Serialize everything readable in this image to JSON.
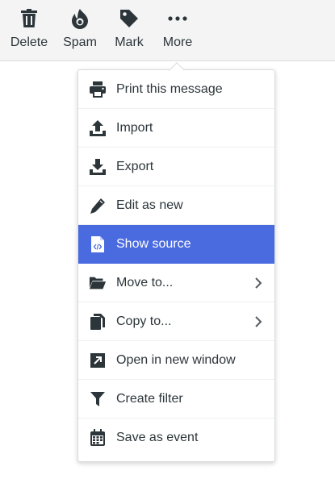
{
  "toolbar": {
    "delete_label": "Delete",
    "spam_label": "Spam",
    "mark_label": "Mark",
    "more_label": "More"
  },
  "menu": {
    "items": [
      {
        "label": "Print this message",
        "icon": "printer-icon"
      },
      {
        "label": "Import",
        "icon": "upload-icon"
      },
      {
        "label": "Export",
        "icon": "download-icon"
      },
      {
        "label": "Edit as new",
        "icon": "pencil-icon"
      },
      {
        "label": "Show source",
        "icon": "code-file-icon",
        "active": true
      },
      {
        "label": "Move to...",
        "icon": "folder-open-icon",
        "submenu": true
      },
      {
        "label": "Copy to...",
        "icon": "copy-icon",
        "submenu": true
      },
      {
        "label": "Open in new window",
        "icon": "external-window-icon"
      },
      {
        "label": "Create filter",
        "icon": "filter-icon"
      },
      {
        "label": "Save as event",
        "icon": "calendar-icon"
      }
    ]
  },
  "colors": {
    "accent": "#4a6ae0",
    "text": "#2c363a",
    "toolbar_bg": "#f4f4f4"
  }
}
